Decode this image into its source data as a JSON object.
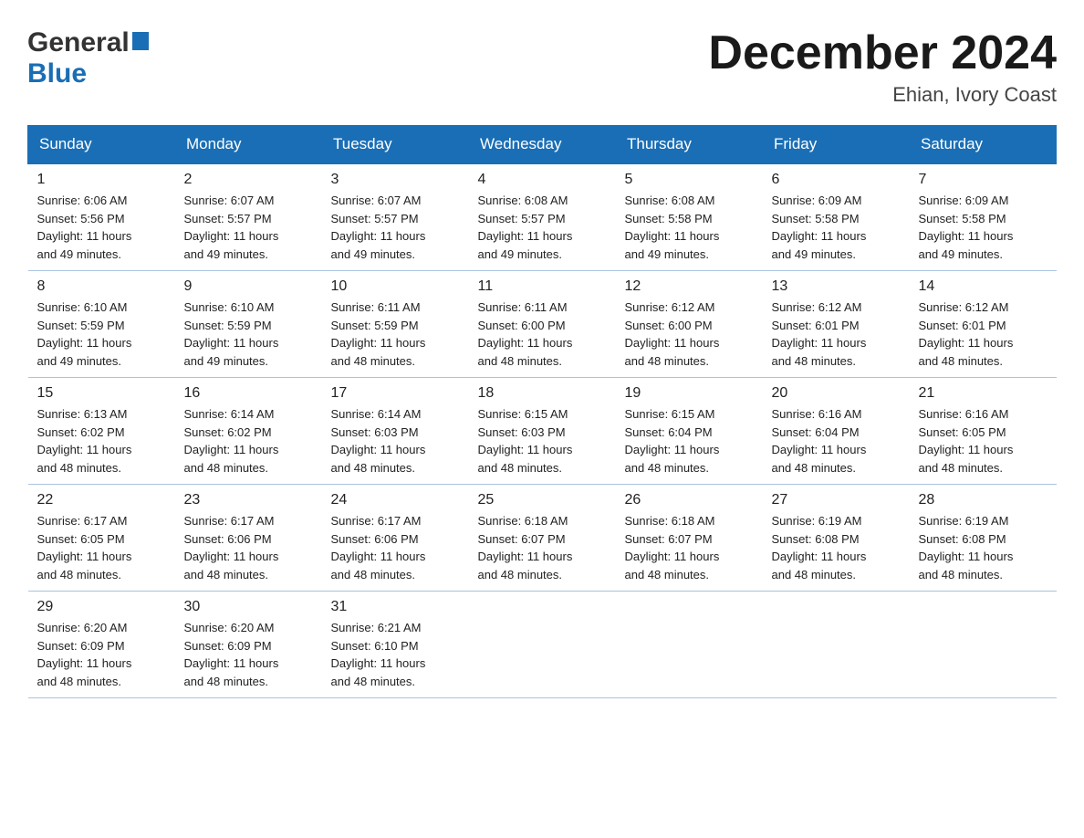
{
  "logo": {
    "line1": "General",
    "line2": "Blue"
  },
  "title": "December 2024",
  "location": "Ehian, Ivory Coast",
  "days_of_week": [
    "Sunday",
    "Monday",
    "Tuesday",
    "Wednesday",
    "Thursday",
    "Friday",
    "Saturday"
  ],
  "weeks": [
    [
      {
        "day": "1",
        "sunrise": "6:06 AM",
        "sunset": "5:56 PM",
        "daylight": "11 hours and 49 minutes."
      },
      {
        "day": "2",
        "sunrise": "6:07 AM",
        "sunset": "5:57 PM",
        "daylight": "11 hours and 49 minutes."
      },
      {
        "day": "3",
        "sunrise": "6:07 AM",
        "sunset": "5:57 PM",
        "daylight": "11 hours and 49 minutes."
      },
      {
        "day": "4",
        "sunrise": "6:08 AM",
        "sunset": "5:57 PM",
        "daylight": "11 hours and 49 minutes."
      },
      {
        "day": "5",
        "sunrise": "6:08 AM",
        "sunset": "5:58 PM",
        "daylight": "11 hours and 49 minutes."
      },
      {
        "day": "6",
        "sunrise": "6:09 AM",
        "sunset": "5:58 PM",
        "daylight": "11 hours and 49 minutes."
      },
      {
        "day": "7",
        "sunrise": "6:09 AM",
        "sunset": "5:58 PM",
        "daylight": "11 hours and 49 minutes."
      }
    ],
    [
      {
        "day": "8",
        "sunrise": "6:10 AM",
        "sunset": "5:59 PM",
        "daylight": "11 hours and 49 minutes."
      },
      {
        "day": "9",
        "sunrise": "6:10 AM",
        "sunset": "5:59 PM",
        "daylight": "11 hours and 49 minutes."
      },
      {
        "day": "10",
        "sunrise": "6:11 AM",
        "sunset": "5:59 PM",
        "daylight": "11 hours and 48 minutes."
      },
      {
        "day": "11",
        "sunrise": "6:11 AM",
        "sunset": "6:00 PM",
        "daylight": "11 hours and 48 minutes."
      },
      {
        "day": "12",
        "sunrise": "6:12 AM",
        "sunset": "6:00 PM",
        "daylight": "11 hours and 48 minutes."
      },
      {
        "day": "13",
        "sunrise": "6:12 AM",
        "sunset": "6:01 PM",
        "daylight": "11 hours and 48 minutes."
      },
      {
        "day": "14",
        "sunrise": "6:12 AM",
        "sunset": "6:01 PM",
        "daylight": "11 hours and 48 minutes."
      }
    ],
    [
      {
        "day": "15",
        "sunrise": "6:13 AM",
        "sunset": "6:02 PM",
        "daylight": "11 hours and 48 minutes."
      },
      {
        "day": "16",
        "sunrise": "6:14 AM",
        "sunset": "6:02 PM",
        "daylight": "11 hours and 48 minutes."
      },
      {
        "day": "17",
        "sunrise": "6:14 AM",
        "sunset": "6:03 PM",
        "daylight": "11 hours and 48 minutes."
      },
      {
        "day": "18",
        "sunrise": "6:15 AM",
        "sunset": "6:03 PM",
        "daylight": "11 hours and 48 minutes."
      },
      {
        "day": "19",
        "sunrise": "6:15 AM",
        "sunset": "6:04 PM",
        "daylight": "11 hours and 48 minutes."
      },
      {
        "day": "20",
        "sunrise": "6:16 AM",
        "sunset": "6:04 PM",
        "daylight": "11 hours and 48 minutes."
      },
      {
        "day": "21",
        "sunrise": "6:16 AM",
        "sunset": "6:05 PM",
        "daylight": "11 hours and 48 minutes."
      }
    ],
    [
      {
        "day": "22",
        "sunrise": "6:17 AM",
        "sunset": "6:05 PM",
        "daylight": "11 hours and 48 minutes."
      },
      {
        "day": "23",
        "sunrise": "6:17 AM",
        "sunset": "6:06 PM",
        "daylight": "11 hours and 48 minutes."
      },
      {
        "day": "24",
        "sunrise": "6:17 AM",
        "sunset": "6:06 PM",
        "daylight": "11 hours and 48 minutes."
      },
      {
        "day": "25",
        "sunrise": "6:18 AM",
        "sunset": "6:07 PM",
        "daylight": "11 hours and 48 minutes."
      },
      {
        "day": "26",
        "sunrise": "6:18 AM",
        "sunset": "6:07 PM",
        "daylight": "11 hours and 48 minutes."
      },
      {
        "day": "27",
        "sunrise": "6:19 AM",
        "sunset": "6:08 PM",
        "daylight": "11 hours and 48 minutes."
      },
      {
        "day": "28",
        "sunrise": "6:19 AM",
        "sunset": "6:08 PM",
        "daylight": "11 hours and 48 minutes."
      }
    ],
    [
      {
        "day": "29",
        "sunrise": "6:20 AM",
        "sunset": "6:09 PM",
        "daylight": "11 hours and 48 minutes."
      },
      {
        "day": "30",
        "sunrise": "6:20 AM",
        "sunset": "6:09 PM",
        "daylight": "11 hours and 48 minutes."
      },
      {
        "day": "31",
        "sunrise": "6:21 AM",
        "sunset": "6:10 PM",
        "daylight": "11 hours and 48 minutes."
      },
      null,
      null,
      null,
      null
    ]
  ],
  "labels": {
    "sunrise": "Sunrise:",
    "sunset": "Sunset:",
    "daylight": "Daylight:"
  }
}
